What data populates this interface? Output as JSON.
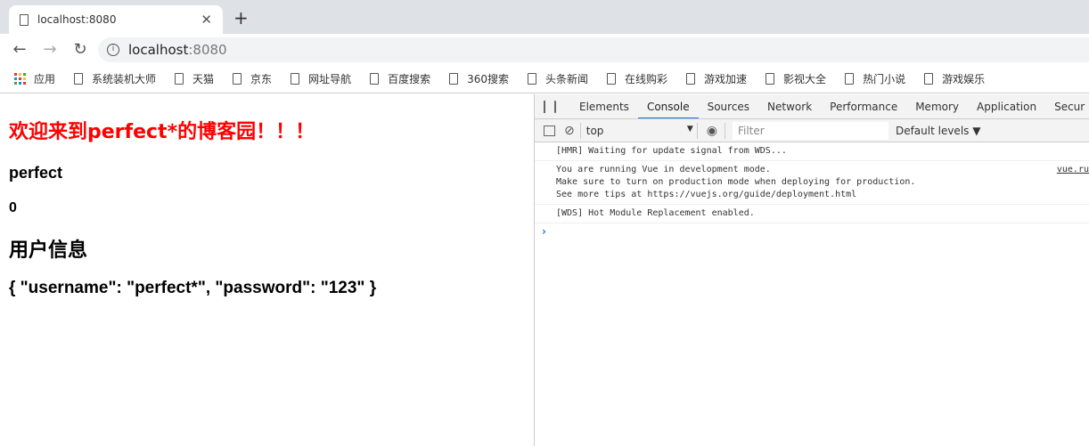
{
  "browser": {
    "tab_title": "localhost:8080",
    "url_host": "localhost",
    "url_port": ":8080"
  },
  "bookmarks": [
    "应用",
    "系统装机大师",
    "天猫",
    "京东",
    "网址导航",
    "百度搜索",
    "360搜索",
    "头条新闻",
    "在线购彩",
    "游戏加速",
    "影视大全",
    "热门小说",
    "游戏娱乐"
  ],
  "page": {
    "heading": "欢迎来到perfect*的博客园！！！",
    "name": "perfect",
    "count": "0",
    "section_title": "用户信息",
    "user_json": "{ \"username\": \"perfect*\", \"password\": \"123\" }",
    "heading_color": "#ff0000"
  },
  "devtools": {
    "tabs": [
      "Elements",
      "Console",
      "Sources",
      "Network",
      "Performance",
      "Memory",
      "Application",
      "Secur"
    ],
    "active_tab": "Console",
    "context": "top",
    "filter_placeholder": "Filter",
    "levels": "Default levels ▼",
    "messages": [
      {
        "lines": [
          "[HMR] Waiting for update signal from WDS..."
        ]
      },
      {
        "lines": [
          "You are running Vue in development mode.",
          "Make sure to turn on production mode when deploying for production.",
          "See more tips at "
        ],
        "link": "https://vuejs.org/guide/deployment.html",
        "source": "vue.ru"
      },
      {
        "lines": [
          "[WDS] Hot Module Replacement enabled."
        ]
      }
    ],
    "prompt": "›"
  }
}
